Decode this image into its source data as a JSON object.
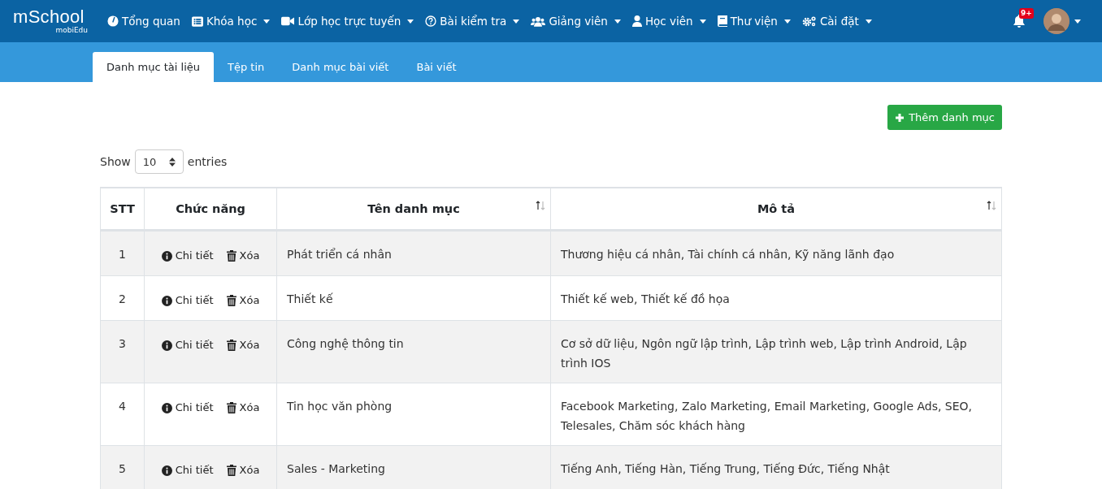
{
  "navbar": {
    "logo": "mSchool",
    "logo_sub": "mobiEdu",
    "items": [
      {
        "label": "Tổng quan",
        "dropdown": false
      },
      {
        "label": "Khóa học",
        "dropdown": true
      },
      {
        "label": "Lớp học trực tuyến",
        "dropdown": true
      },
      {
        "label": "Bài kiểm tra",
        "dropdown": true
      },
      {
        "label": "Giảng viên",
        "dropdown": true
      },
      {
        "label": "Học viên",
        "dropdown": true
      },
      {
        "label": "Thư viện",
        "dropdown": true
      },
      {
        "label": "Cài đặt",
        "dropdown": true
      }
    ],
    "notification_badge": "9+"
  },
  "tabs": [
    {
      "label": "Danh mục tài liệu",
      "selected": true
    },
    {
      "label": "Tệp tin",
      "selected": false
    },
    {
      "label": "Danh mục bài viết",
      "selected": false
    },
    {
      "label": "Bài viết",
      "selected": false
    }
  ],
  "add_button": "Thêm danh mục",
  "length_control": {
    "prefix": "Show",
    "value": "10",
    "suffix": "entries"
  },
  "table": {
    "columns": [
      {
        "label": "STT",
        "sortable": false
      },
      {
        "label": "Chức năng",
        "sortable": false
      },
      {
        "label": "Tên danh mục",
        "sortable": true
      },
      {
        "label": "Mô tả",
        "sortable": true
      }
    ],
    "rows": [
      {
        "stt": "1",
        "actions": [
          "Chi tiết",
          "Xóa"
        ],
        "name": "Phát triển cá nhân",
        "description": "Thương hiệu cá nhân, Tài chính cá nhân, Kỹ năng lãnh đạo"
      },
      {
        "stt": "2",
        "actions": [
          "Chi tiết",
          "Xóa"
        ],
        "name": "Thiết kế",
        "description": "Thiết kế web, Thiết kế đồ họa"
      },
      {
        "stt": "3",
        "actions": [
          "Chi tiết",
          "Xóa"
        ],
        "name": "Công nghệ thông tin",
        "description": "Cơ sở dữ liệu, Ngôn ngữ lập trình, Lập trình web, Lập trình Android, Lập trình IOS"
      },
      {
        "stt": "4",
        "actions": [
          "Chi tiết",
          "Xóa"
        ],
        "name": "Tin học văn phòng",
        "description": "Facebook Marketing, Zalo Marketing, Email Marketing, Google Ads, SEO, Telesales, Chăm sóc khách hàng"
      },
      {
        "stt": "5",
        "actions": [
          "Chi tiết",
          "Xóa"
        ],
        "name": "Sales - Marketing",
        "description": "Tiếng Anh, Tiếng Hàn, Tiếng Trung, Tiếng Đức, Tiếng Nhật"
      }
    ]
  }
}
